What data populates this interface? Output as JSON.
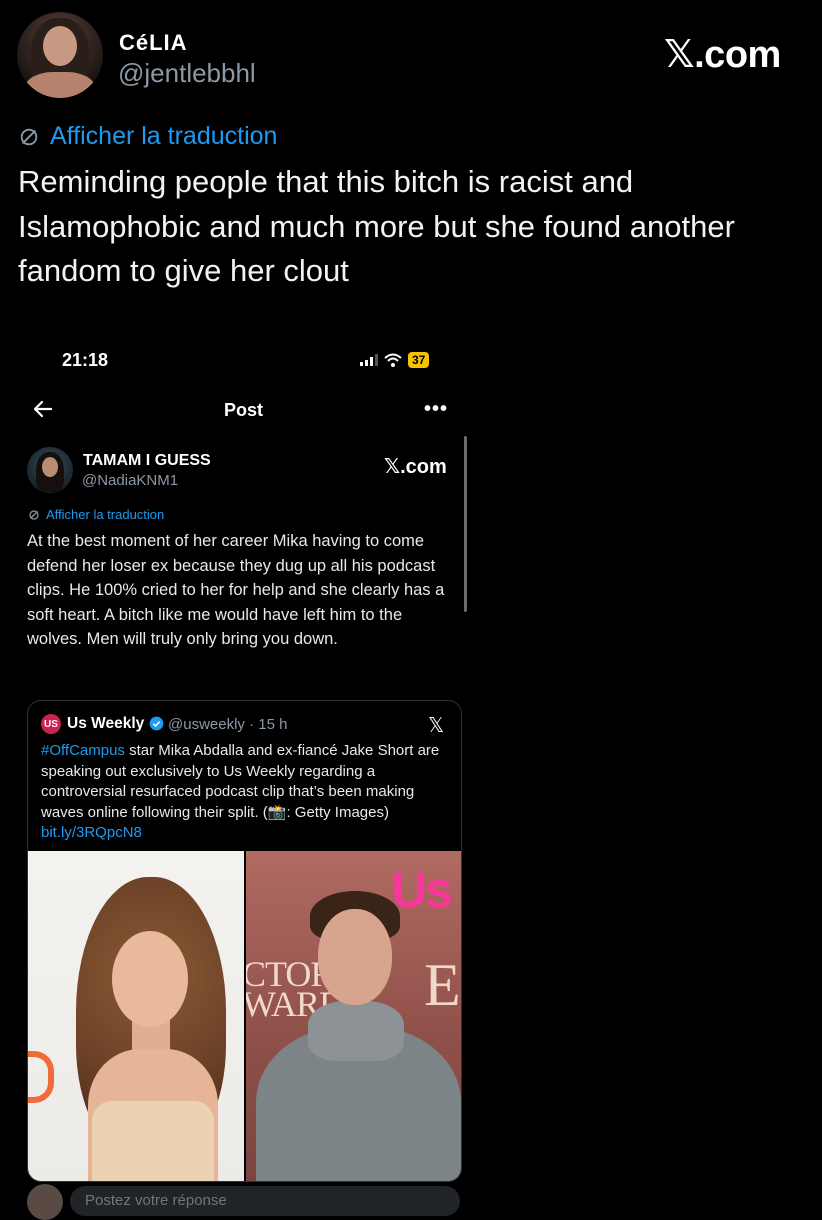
{
  "outer_tweet": {
    "display_name": "CéLIA",
    "handle": "@jentlebbhl",
    "watermark": "X.com",
    "watermark_x": "𝕏",
    "watermark_rest": ".com",
    "translate_label": "Afficher la traduction",
    "text": "Reminding people that this bitch is racist and Islamophobic and much more but she found another fandom to give her clout"
  },
  "inner_screenshot": {
    "status_time": "21:18",
    "battery": "37",
    "page_title": "Post",
    "more_label": "•••",
    "tweet": {
      "display_name": "TAMAM I GUESS",
      "handle": "@NadiaKNM1",
      "watermark_x": "𝕏",
      "watermark_rest": ".com",
      "translate_label": "Afficher la traduction",
      "text": "At the best moment of her career Mika having to come defend her loser ex because they dug up all his podcast clips. He 100% cried to her for help and she clearly has a soft heart. A bitch like me would have left him to the wolves. Men will truly only bring you down."
    },
    "quote": {
      "logo_text": "US",
      "name": "Us Weekly",
      "handle_time": "@usweekly · 15 h",
      "x_icon": "𝕏",
      "hashtag": "#OffCampus",
      "text_body": " star Mika Abdalla and ex-fiancé Jake Short are speaking out exclusively to Us Weekly regarding a controversial resurfaced podcast clip that’s been making waves online following their split. (📸: Getty Images)",
      "link": "bit.ly/3RQpcN8",
      "photo_us_logo": "Us",
      "photo_actor_text": "CTOR\nWARDS",
      "photo_e_text": "E"
    },
    "reply_placeholder": "Postez votre réponse"
  },
  "colors": {
    "background": "#000000",
    "link": "#1d9bf0",
    "secondary_text": "#8b98a5",
    "battery": "#f5c400",
    "us_weekly_brand": "#c9244f"
  },
  "icons": {
    "translate": "translate-icon",
    "back": "back-arrow-icon",
    "more": "more-dots-icon",
    "verified": "verified-badge-icon",
    "signal": "signal-icon",
    "wifi": "wifi-icon"
  }
}
